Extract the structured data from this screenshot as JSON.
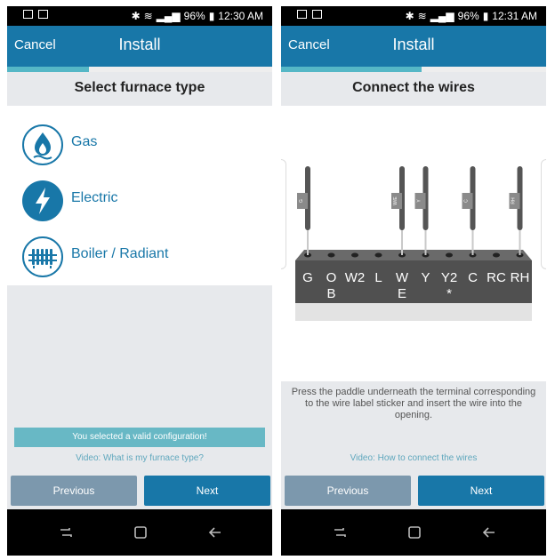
{
  "left": {
    "status": {
      "time": "12:30 AM",
      "battery": "96%"
    },
    "appbar": {
      "cancel": "Cancel",
      "title": "Install"
    },
    "progress": 0.31,
    "section_title": "Select furnace type",
    "options": [
      {
        "label": "Gas",
        "icon": "gas-flame-icon"
      },
      {
        "label": "Electric",
        "icon": "lightning-icon"
      },
      {
        "label": "Boiler / Radiant",
        "icon": "radiator-icon"
      }
    ],
    "valid_message": "You selected a valid configuration!",
    "video_link": "Video: What is my furnace type?",
    "buttons": {
      "previous": "Previous",
      "next": "Next"
    }
  },
  "right": {
    "status": {
      "time": "12:31 AM",
      "battery": "96%"
    },
    "appbar": {
      "cancel": "Cancel",
      "title": "Install"
    },
    "progress": 0.53,
    "section_title": "Connect the wires",
    "terminals": [
      "G",
      "O",
      "W2",
      "L",
      "W",
      "Y",
      "Y2",
      "C",
      "RC",
      "RH"
    ],
    "sublabels": [
      "",
      "B",
      "",
      "",
      "E",
      "",
      "*",
      "",
      "",
      ""
    ],
    "wires": [
      {
        "terminal": "G",
        "tag": "G"
      },
      {
        "terminal": "W",
        "tag": "W/E"
      },
      {
        "terminal": "Y",
        "tag": "Y"
      },
      {
        "terminal": "C",
        "tag": "C"
      },
      {
        "terminal": "RH",
        "tag": "RH"
      }
    ],
    "instructions": "Press the paddle underneath the terminal corresponding to the wire label sticker and insert the wire into the opening.",
    "video_link": "Video: How to connect the wires",
    "buttons": {
      "previous": "Previous",
      "next": "Next"
    }
  },
  "colors": {
    "primary": "#1877a8",
    "accent": "#55b7c6",
    "prev_button": "#7c98ad",
    "valid_bg": "#68b8c5"
  }
}
